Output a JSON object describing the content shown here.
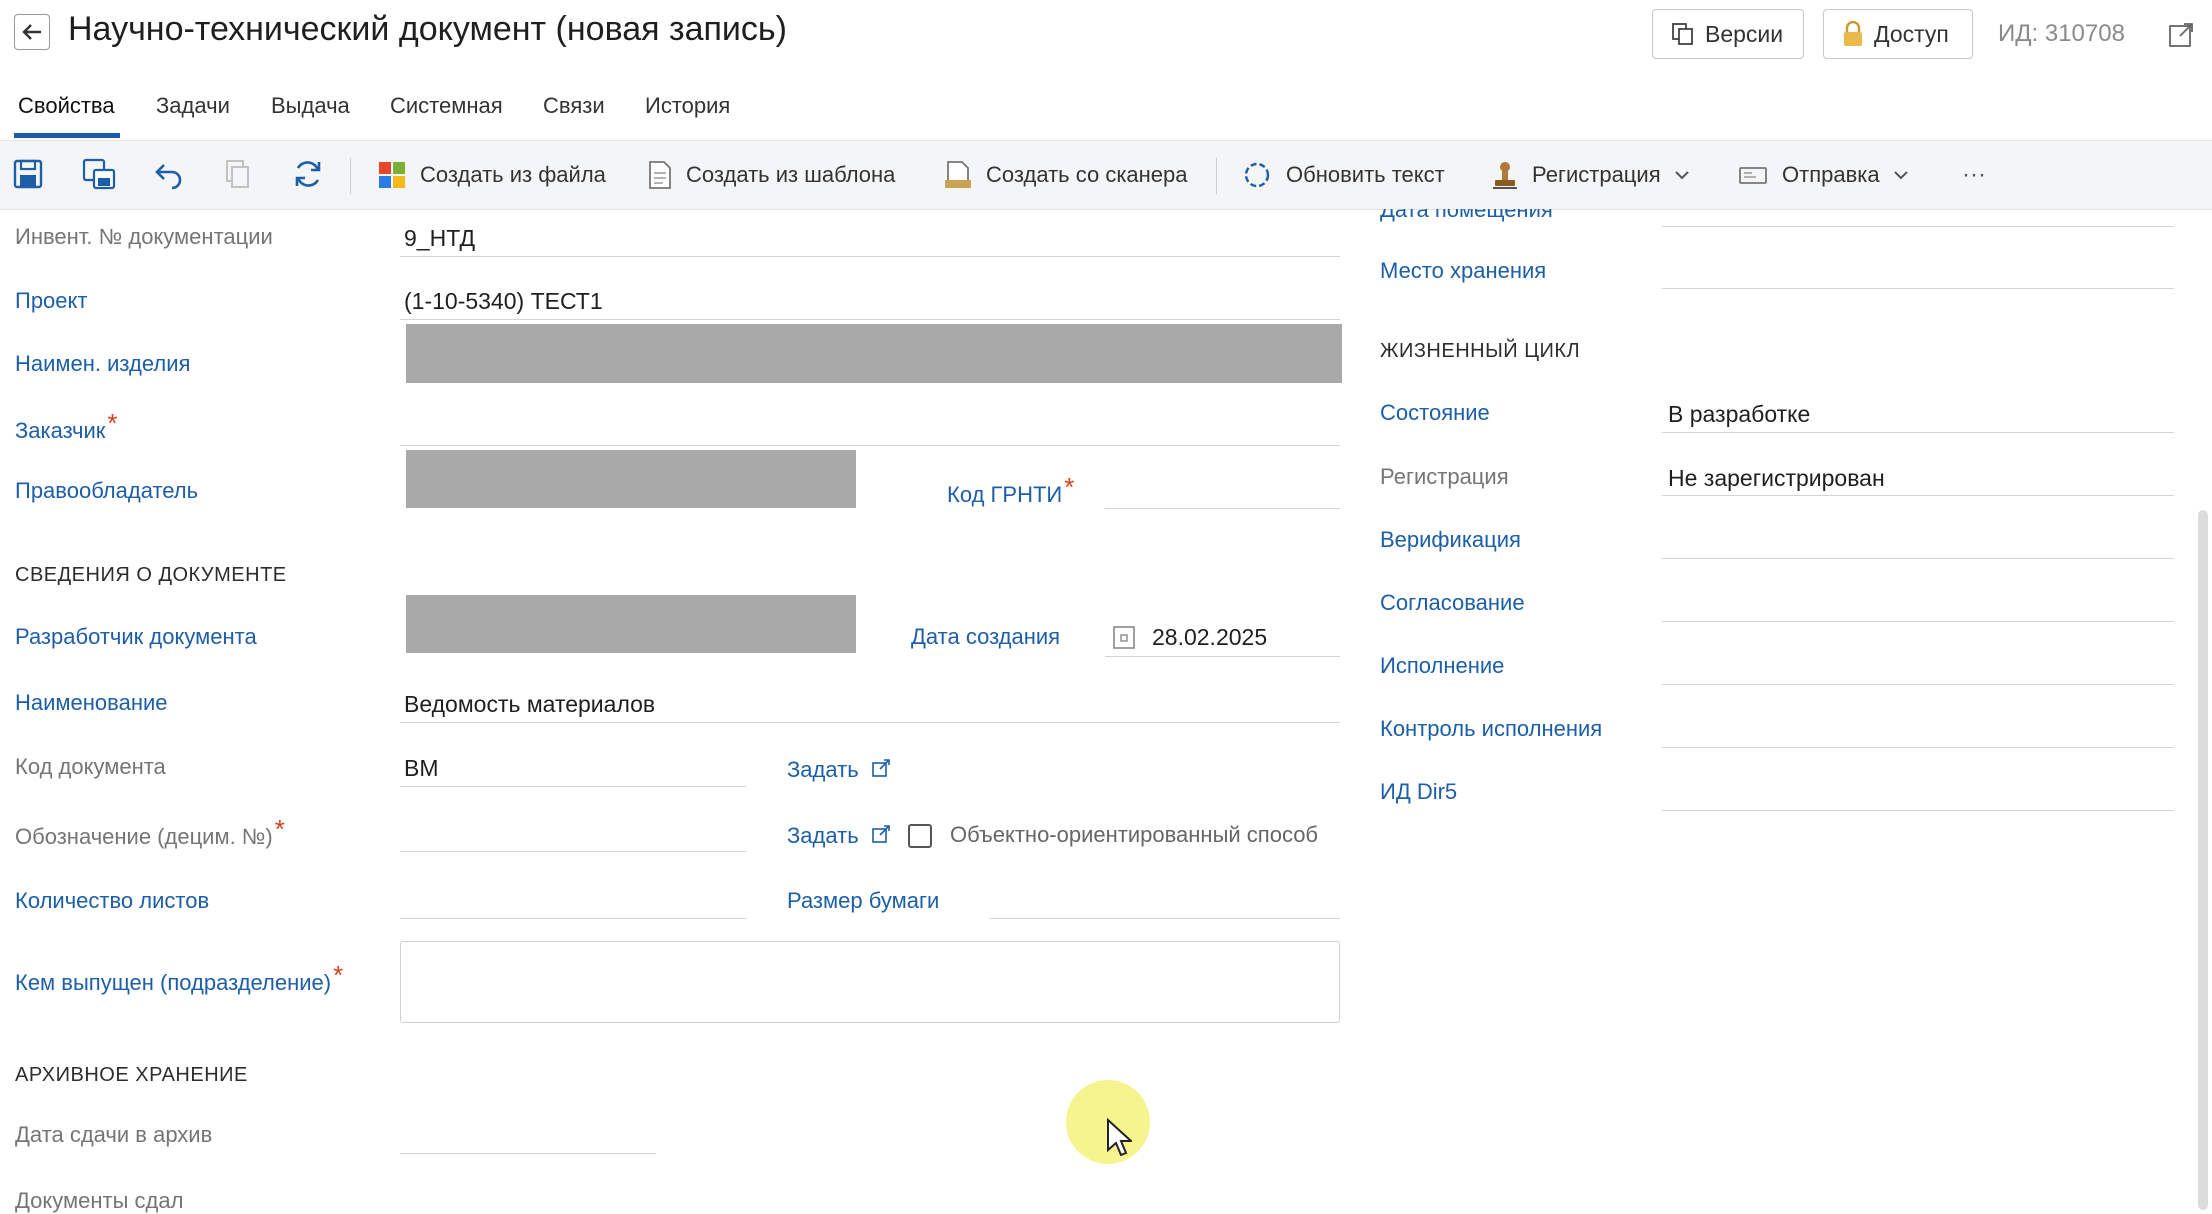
{
  "header": {
    "title": "Научно-технический документ (новая запись)",
    "versions_label": "Версии",
    "access_label": "Доступ",
    "id_label": "ИД: 310708"
  },
  "tabs": [
    {
      "label": "Свойства",
      "active": true
    },
    {
      "label": "Задачи"
    },
    {
      "label": "Выдача"
    },
    {
      "label": "Системная"
    },
    {
      "label": "Связи"
    },
    {
      "label": "История"
    }
  ],
  "toolbar": {
    "create_from_file": "Создать из файла",
    "create_from_template": "Создать из шаблона",
    "create_from_scanner": "Создать со сканера",
    "update_text": "Обновить текст",
    "registration": "Регистрация",
    "sending": "Отправка",
    "more": "···"
  },
  "left": {
    "inv_label": "Инвент. № документации",
    "inv_value": "9_НТД",
    "project_label": "Проект",
    "project_value": "(1-10-5340) ТЕСТ1",
    "product_label": "Наимен. изделия",
    "customer_label": "Заказчик",
    "rightholder_label": "Правообладатель",
    "grnti_label": "Код ГРНТИ",
    "section_doc": "СВЕДЕНИЯ О ДОКУМЕНТЕ",
    "developer_label": "Разработчик документа",
    "created_label": "Дата создания",
    "created_value": "28.02.2025",
    "name_label": "Наименование",
    "name_value": "Ведомость материалов",
    "code_label": "Код документа",
    "code_value": "ВМ",
    "set_label_1": "Задать",
    "designation_label": "Обозначение (децим. №)",
    "set_label_2": "Задать",
    "object_oriented_label": "Объектно-ориентированный способ",
    "sheets_label": "Количество листов",
    "paper_label": "Размер бумаги",
    "issued_by_label": "Кем выпущен (подразделение)",
    "section_archive": "АРХИВНОЕ ХРАНЕНИЕ",
    "archive_date_label": "Дата сдачи в архив",
    "docs_handed_label": "Документы сдал"
  },
  "right": {
    "placement_date_label": "Дата помещения",
    "storage_label": "Место хранения",
    "section_lifecycle": "ЖИЗНЕННЫЙ ЦИКЛ",
    "state_label": "Состояние",
    "state_value": "В разработке",
    "registration_label": "Регистрация",
    "registration_value": "Не зарегистрирован",
    "verification_label": "Верификация",
    "approval_label": "Согласование",
    "execution_label": "Исполнение",
    "exec_control_label": "Контроль исполнения",
    "dir5_label": "ИД Dir5"
  },
  "colors": {
    "label_blue": "#1d5ea8",
    "required_red": "#d2421d",
    "tab_underline": "#1a5aa8"
  }
}
